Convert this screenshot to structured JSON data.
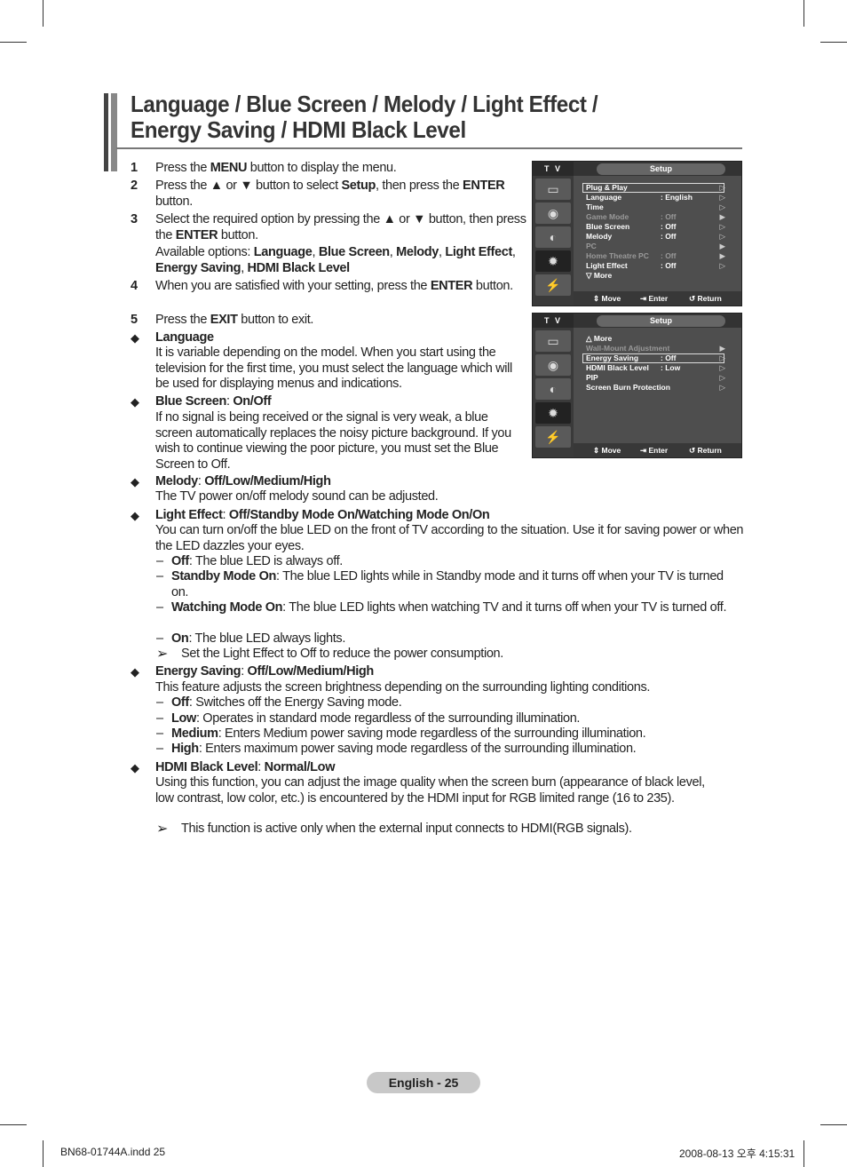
{
  "title": [
    "Language / Blue Screen / Melody / Light Effect /",
    "Energy Saving / HDMI Black Level"
  ],
  "steps": [
    {
      "n": "1",
      "segs": [
        [
          "Press the "
        ],
        [
          "MENU",
          1
        ],
        [
          " button to display the menu."
        ]
      ]
    },
    {
      "n": "2",
      "segs": [
        [
          "Press the ▲ or ▼ button to select "
        ],
        [
          "Setup",
          1
        ],
        [
          ", then press the "
        ],
        [
          "ENTER",
          1
        ],
        [
          " button."
        ]
      ]
    },
    {
      "n": "3",
      "segs": [
        [
          "Select the required option by pressing the ▲ or ▼ button, then press the "
        ],
        [
          "ENTER",
          1
        ],
        [
          " button."
        ]
      ]
    },
    {
      "n": "",
      "segs": [
        [
          "Available options: "
        ],
        [
          "Language",
          1
        ],
        [
          ", "
        ],
        [
          "Blue Screen",
          1
        ],
        [
          ", "
        ],
        [
          "Melody",
          1
        ],
        [
          ", "
        ],
        [
          "Light Effect",
          1
        ],
        [
          ", "
        ],
        [
          "Energy Saving",
          1
        ],
        [
          ", "
        ],
        [
          "HDMI Black Level",
          1
        ]
      ]
    },
    {
      "n": "4",
      "segs": [
        [
          "When you are satisfied with your setting, press the "
        ],
        [
          "ENTER",
          1
        ],
        [
          " button."
        ]
      ]
    },
    {
      "n": "5",
      "segs": [
        [
          "Press the "
        ],
        [
          "EXIT",
          1
        ],
        [
          " button to exit."
        ]
      ]
    }
  ],
  "sections": {
    "language": {
      "head": [
        [
          "Language",
          1
        ]
      ],
      "body": [
        [
          "It is variable depending on the model. When you start using the television for the first time, you must select the language which will be used for displaying menus and indications."
        ]
      ]
    },
    "blue": {
      "head": [
        [
          "Blue Screen",
          1
        ],
        [
          ": "
        ],
        [
          "On/Off",
          1
        ]
      ],
      "body": [
        [
          "If no signal is being received or the signal is very weak, a blue screen automatically replaces the noisy picture background. If you wish to continue viewing the poor picture, you must set the Blue Screen to Off."
        ]
      ]
    },
    "melody": {
      "head": [
        [
          "Melody",
          1
        ],
        [
          ": "
        ],
        [
          "Off/Low/Medium/High",
          1
        ]
      ],
      "body": [
        [
          "The TV power on/off melody sound can be adjusted."
        ]
      ]
    },
    "light": {
      "head": [
        [
          "Light Effect",
          1
        ],
        [
          ": "
        ],
        [
          "Off/Standby Mode On/Watching Mode On/On",
          1
        ]
      ],
      "body": [
        [
          "You can turn on/off the blue LED on the front of TV according to the situation. Use it for saving power or when the LED dazzles your eyes."
        ]
      ],
      "items": [
        [
          [
            "Off",
            1
          ],
          [
            ": The blue LED is always off."
          ]
        ],
        [
          [
            "Standby Mode On",
            1
          ],
          [
            ": The blue LED lights while in Standby mode and it turns off when your TV is turned on."
          ]
        ],
        [
          [
            "Watching Mode On",
            1
          ],
          [
            ": The blue LED lights when watching TV and it turns off when your TV is turned off."
          ]
        ],
        [
          [
            "On",
            1
          ],
          [
            ": The blue LED always lights."
          ]
        ]
      ],
      "note": "Set the Light Effect to Off to reduce the power consumption."
    },
    "energy": {
      "head": [
        [
          "Energy Saving",
          1
        ],
        [
          ": "
        ],
        [
          "Off/Low/Medium/High",
          1
        ]
      ],
      "body": [
        [
          "This feature adjusts the screen brightness depending on the surrounding lighting conditions."
        ]
      ],
      "items": [
        [
          [
            "Off",
            1
          ],
          [
            ": Switches off the Energy Saving mode."
          ]
        ],
        [
          [
            "Low",
            1
          ],
          [
            ": Operates in standard mode regardless of the surrounding illumination."
          ]
        ],
        [
          [
            "Medium",
            1
          ],
          [
            ": Enters Medium power saving mode regardless of the surrounding illumination."
          ]
        ],
        [
          [
            "High",
            1
          ],
          [
            ": Enters maximum power saving mode regardless of the surrounding illumination."
          ]
        ]
      ]
    },
    "hdmi": {
      "head": [
        [
          "HDMI Black Level",
          1
        ],
        [
          ": "
        ],
        [
          "Normal/Low",
          1
        ]
      ],
      "body": [
        [
          "Using this function, you can adjust the image quality when the screen burn (appearance of black level, low contrast, low color, etc.) is encountered by the HDMI input for RGB limited range (16 to 235)."
        ]
      ],
      "note": "This function is active only when the external input connects to HDMI(RGB signals)."
    }
  },
  "menu1": {
    "tv": "T V",
    "title": "Setup",
    "rows": [
      {
        "l": "Plug & Play",
        "v": "",
        "a": "▷"
      },
      {
        "l": "Language",
        "v": ": English",
        "a": "▷"
      },
      {
        "l": "Time",
        "v": "",
        "a": "▷"
      },
      {
        "l": "Game Mode",
        "v": ": Off",
        "a": "▶",
        "dim": true
      },
      {
        "l": "Blue Screen",
        "v": ": Off",
        "a": "▷"
      },
      {
        "l": "Melody",
        "v": ": Off",
        "a": "▷"
      },
      {
        "l": "PC",
        "v": "",
        "a": "▶",
        "dim": true
      },
      {
        "l": "Home Theatre PC",
        "v": ": Off",
        "a": "▶",
        "dim": true
      },
      {
        "l": "Light Effect",
        "v": ": Off",
        "a": "▷"
      },
      {
        "l": "▽  More",
        "v": "",
        "a": ""
      }
    ],
    "selected": 0,
    "footer": {
      "move": "⇕ Move",
      "enter": "⇥ Enter",
      "ret": "↺ Return"
    }
  },
  "menu2": {
    "tv": "T V",
    "title": "Setup",
    "rows": [
      {
        "l": "△  More",
        "v": "",
        "a": ""
      },
      {
        "l": "Wall-Mount Adjustment",
        "v": "",
        "a": "▶",
        "dim": true
      },
      {
        "l": "Energy Saving",
        "v": ": Off",
        "a": "▷"
      },
      {
        "l": "HDMI Black Level",
        "v": ": Low",
        "a": "▷"
      },
      {
        "l": "PIP",
        "v": "",
        "a": "▷"
      },
      {
        "l": "Screen Burn Protection",
        "v": "",
        "a": "▷"
      }
    ],
    "selected": 2,
    "footer": {
      "move": "⇕ Move",
      "enter": "⇥ Enter",
      "ret": "↺ Return"
    }
  },
  "footer": {
    "page": "English - 25",
    "file": "BN68-01744A.indd   25",
    "date": "2008-08-13   오후 4:15:31"
  }
}
